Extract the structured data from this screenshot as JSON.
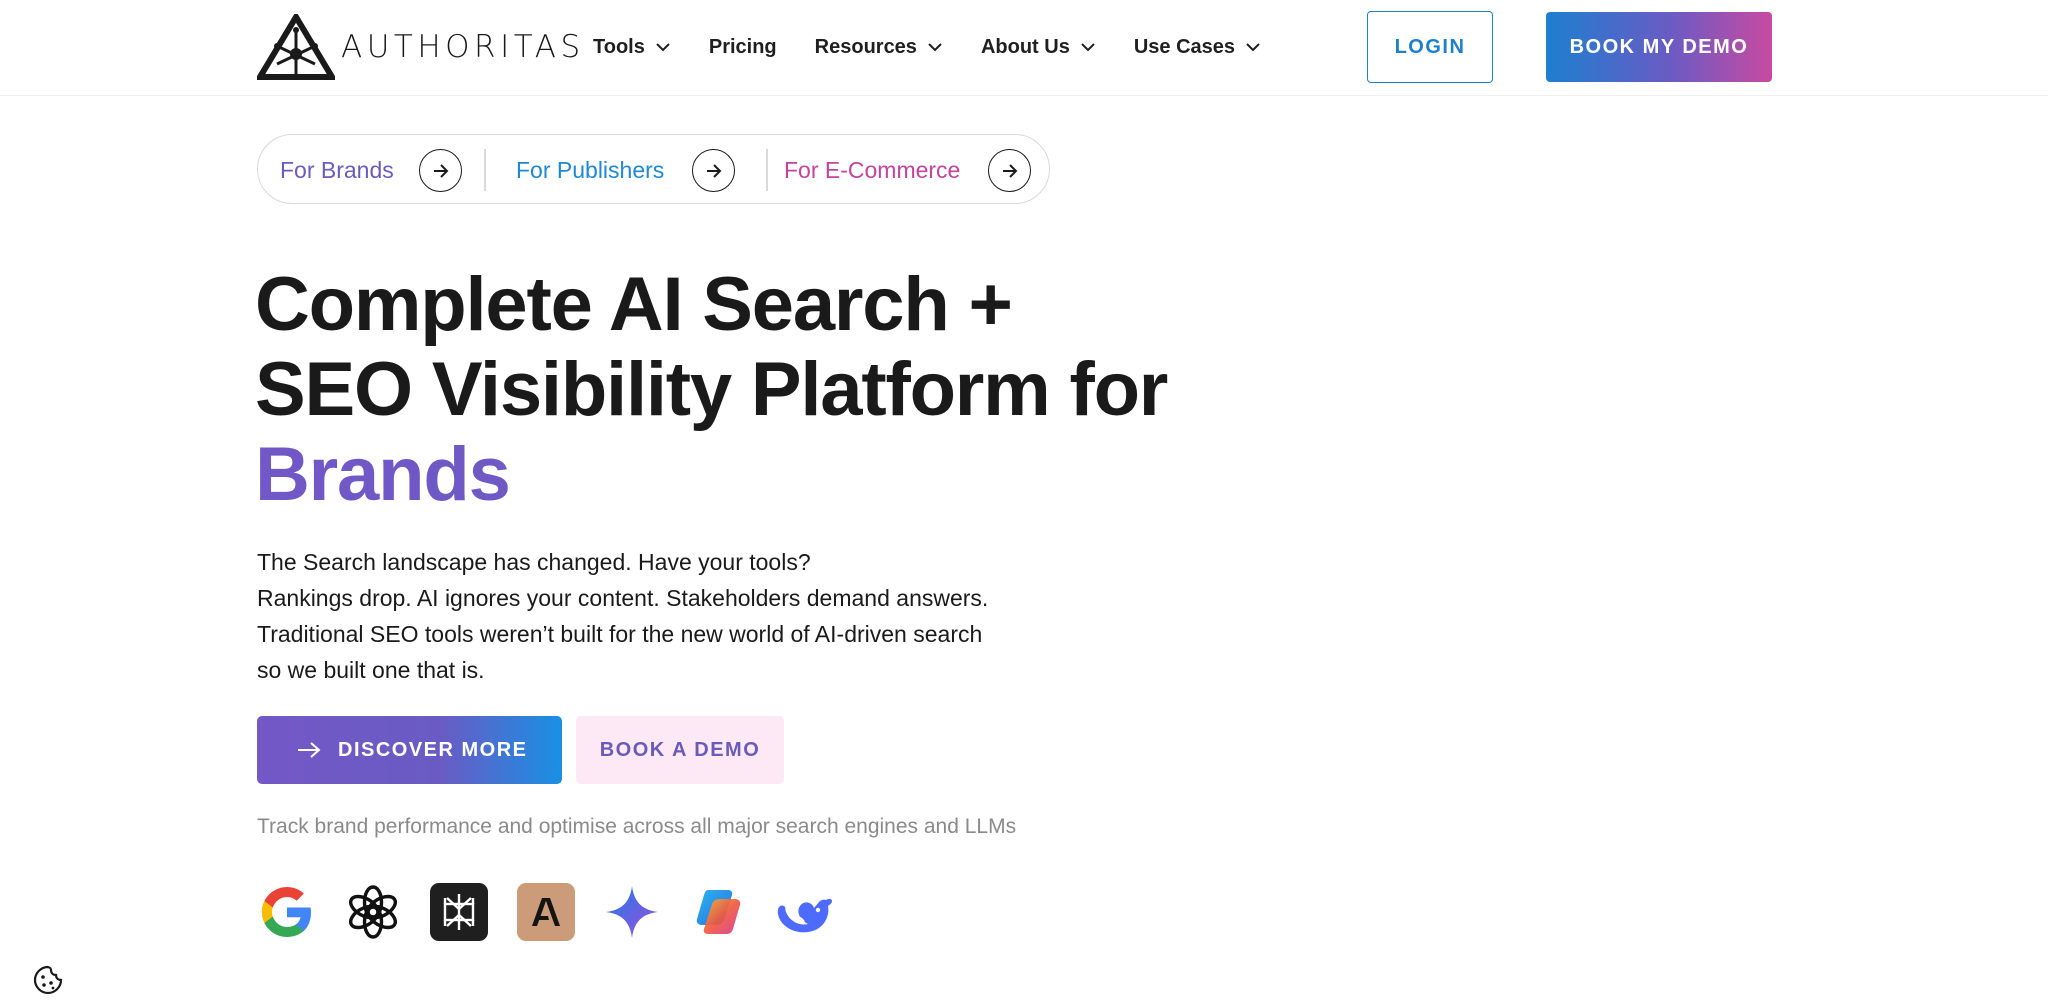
{
  "brand": {
    "name": "AUTHORITAS"
  },
  "nav": {
    "items": [
      {
        "label": "Tools",
        "dropdown": true
      },
      {
        "label": "Pricing",
        "dropdown": false
      },
      {
        "label": "Resources",
        "dropdown": true
      },
      {
        "label": "About Us",
        "dropdown": true
      },
      {
        "label": "Use Cases",
        "dropdown": true
      }
    ],
    "login_label": "LOGIN",
    "demo_label": "BOOK MY DEMO"
  },
  "audience": {
    "brands": {
      "label": "For Brands",
      "color": "#6a5bbf"
    },
    "publishers": {
      "label": "For Publishers",
      "color": "#1e88d2"
    },
    "ecommerce": {
      "label": "For E-Commerce",
      "color": "#c2449c"
    }
  },
  "hero": {
    "title_line1": "Complete AI Search +",
    "title_line2": "SEO Visibility Platform for",
    "title_accent": "Brands",
    "desc": [
      "The Search landscape has changed. Have your tools?",
      "Rankings drop. AI ignores your content. Stakeholders demand answers.",
      "Traditional SEO tools weren’t built for the new world of AI-driven search",
      "so we built one that is."
    ],
    "discover_label": "DISCOVER MORE",
    "book_label": "BOOK A DEMO",
    "track_text": "Track brand performance and optimise across all major search engines and LLMs"
  },
  "engines": [
    {
      "icon": "google-icon"
    },
    {
      "icon": "openai-icon"
    },
    {
      "icon": "perplexity-icon"
    },
    {
      "icon": "anthropic-icon"
    },
    {
      "icon": "gemini-icon"
    },
    {
      "icon": "copilot-icon"
    },
    {
      "icon": "deepseek-icon"
    }
  ],
  "colors": {
    "accent_blue": "#1f7fc9",
    "accent_purple": "#6a5bc4",
    "accent_pink": "#c84aa0",
    "text": "#1a1a1a",
    "muted": "#8a8a8a"
  }
}
